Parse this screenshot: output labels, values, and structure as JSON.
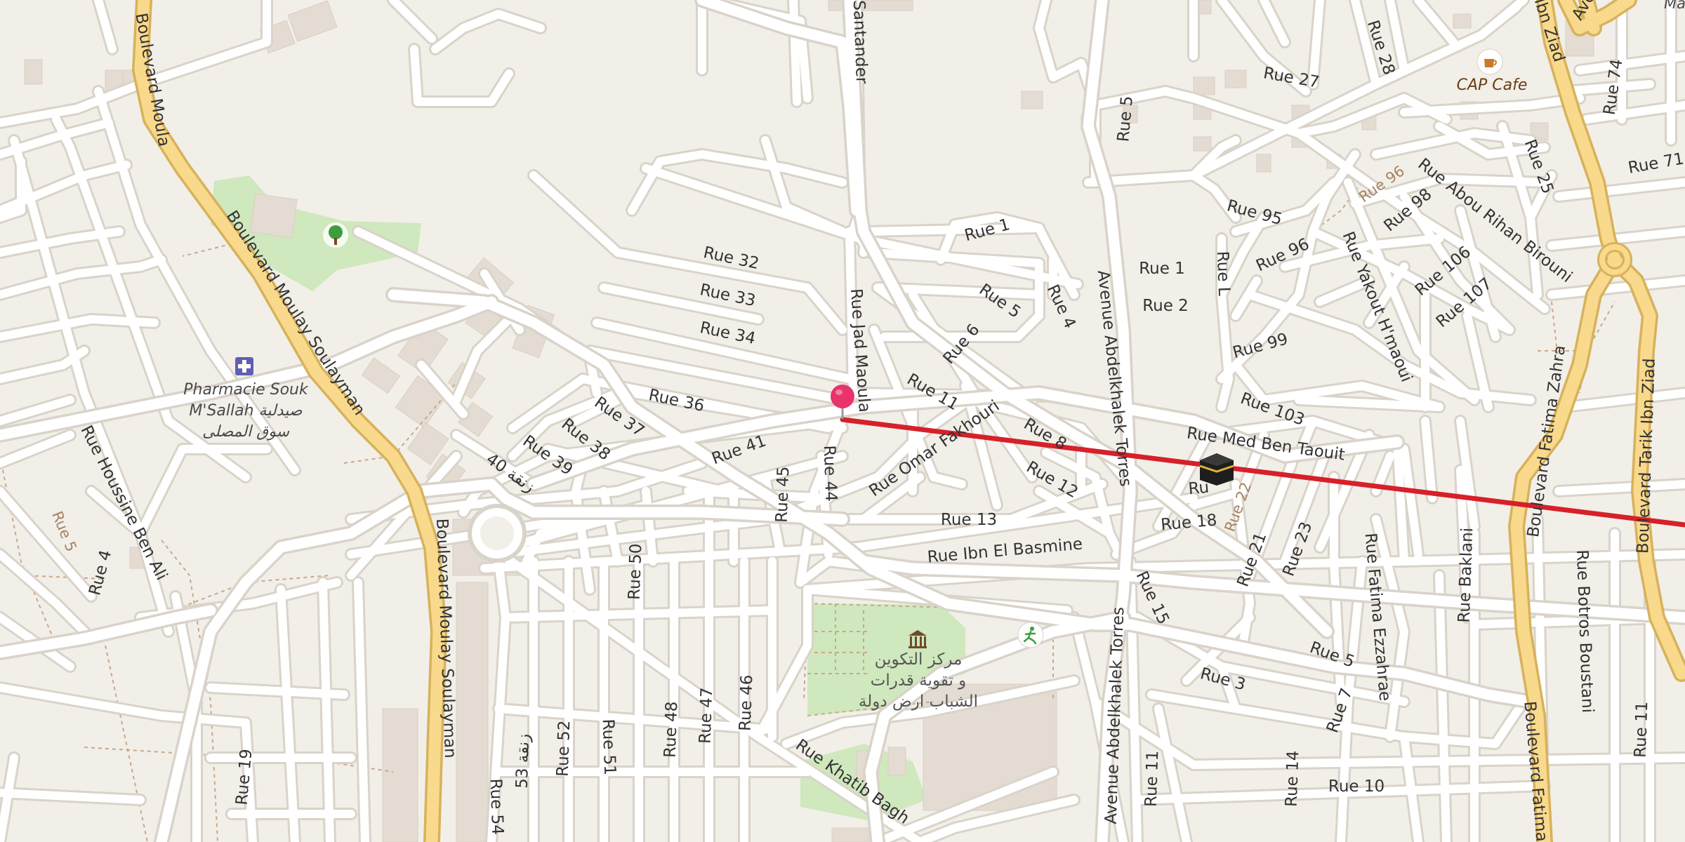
{
  "map": {
    "colors": {
      "background": "#f2efe9",
      "road": "#ffffff",
      "road_casing": "#d9d3c9",
      "major_road": "#f9d98c",
      "major_road_casing": "#d7b25c",
      "park": "#cfe8bd",
      "building": "#e4dcd2",
      "route_line": "#d6202a",
      "pin": "#e8336b",
      "path": "#c8a889",
      "label": "#333333",
      "poi_blue": "#5f5fb5",
      "poi_green": "#3f9d3f",
      "poi_brown": "#7a4a1f"
    },
    "major_roads": {
      "boulevard_moulay_soulayman": "Boulevard Moulay Soulayman",
      "boulevard_moulay_top": "Boulevard Moula",
      "boulevard_fatima_zahra": "Boulevard Fatima Zahra",
      "boulevard_fatima_bottom": "Boulevard Fatima",
      "boulevard_tarik_ibn_ziad": "Boulevard Tarik Ibn Ziad",
      "ibn_ziad_top": "Ibn Ziad",
      "ave_top": "Ave"
    },
    "streets": {
      "santander": "Santander",
      "rue_1": "Rue 1",
      "rue_1_b": "Rue 1",
      "rue_2": "Rue 2",
      "rue_3": "Rue 3",
      "rue_4": "Rue 4",
      "rue_4_left": "Rue 4",
      "rue_5": "Rue 5",
      "rue_5_bottom": "Rue 5",
      "rue_5_path": "Rue 5",
      "rue_5_top": "Rue 5",
      "rue_6": "Rue 6",
      "rue_7": "Rue 7",
      "rue_8": "Rue 8",
      "rue_10": "Rue 10",
      "rue_11": "Rue 11",
      "rue_11_bottom": "Rue 11",
      "rue_11_right": "Rue 11",
      "rue_12": "Rue 12",
      "rue_13": "Rue 13",
      "rue_14": "Rue 14",
      "rue_15": "Rue 15",
      "rue_18": "Rue 18",
      "rue_19": "Rue 19",
      "rue_21": "Rue 21",
      "rue_22": "Rue 22",
      "rue_23": "Rue 23",
      "rue_25": "Rue 25",
      "rue_27": "Rue 27",
      "rue_28": "Rue 28",
      "rue_32": "Rue 32",
      "rue_33": "Rue 33",
      "rue_34": "Rue 34",
      "rue_36": "Rue 36",
      "rue_37": "Rue 37",
      "rue_38": "Rue 38",
      "rue_39": "Rue 39",
      "rue_40": "زنقة 40",
      "rue_41": "Rue 41",
      "rue_44": "Rue 44",
      "rue_45": "Rue 45",
      "rue_46": "Rue 46",
      "rue_47": "Rue 47",
      "rue_48": "Rue 48",
      "rue_50": "Rue 50",
      "rue_51": "Rue 51",
      "rue_52": "Rue 52",
      "rue_53": "زنقة 53",
      "rue_54": "Rue 54",
      "rue_71": "Rue 71",
      "rue_74": "Rue 74",
      "rue_95": "Rue 95",
      "rue_96": "Rue 96",
      "rue_96_path": "Rue 96",
      "rue_98": "Rue 98",
      "rue_99": "Rue 99",
      "rue_103": "Rue 103",
      "rue_106": "Rue 106",
      "rue_107": "Rue 107",
      "rue_l": "Rue L",
      "rue_jad_maoula": "Rue Jad Maoula",
      "rue_omar_fakhouri": "Rue Omar Fakhouri",
      "rue_med_ben_taouit": "Rue Med Ben Taouit",
      "rue_ibn_el_basmine": "Rue Ibn El Basmine",
      "rue_fatima_ezzahrae": "Rue Fatima Ezzahrae",
      "rue_baklani": "Rue Baklani",
      "rue_botros_boustani": "Rue Botros Boustani",
      "rue_yakout_hmaoui": "Rue Yakout H'maoui",
      "rue_abou_rihan_birouni": "Rue Abou Rihan Birouni",
      "rue_houssine_ben_ali": "Rue Houssine Ben Ali",
      "rue_khatib_baghdadi": "Rue Khatib Bagh",
      "ave_abdelkhalek_torres": "Avenue Abdelkhalek Torres",
      "ave_abdelkhalek_torres_2": "Avenue Abdelkhalek Torres",
      "rue_partial": "Ru"
    },
    "pois": {
      "pharmacie_name": "Pharmacie Souk",
      "pharmacie_name_2": "M'Sallah صيدلية",
      "pharmacie_name_3": "سوق المصلى",
      "cap_cafe": "CAP Cafe",
      "centre_line1": "مركز التكوين",
      "centre_line2": "و تقوية قدرات",
      "centre_line3": "الشباب ارض دولة",
      "masjid": "Masjd"
    },
    "icons": {
      "pin": "map-pin-icon",
      "kaaba": "kaaba-icon",
      "pharmacy": "pharmacy-icon",
      "tree": "tree-icon",
      "cafe": "cafe-icon",
      "museum": "museum-icon",
      "sports": "sports-icon"
    }
  }
}
